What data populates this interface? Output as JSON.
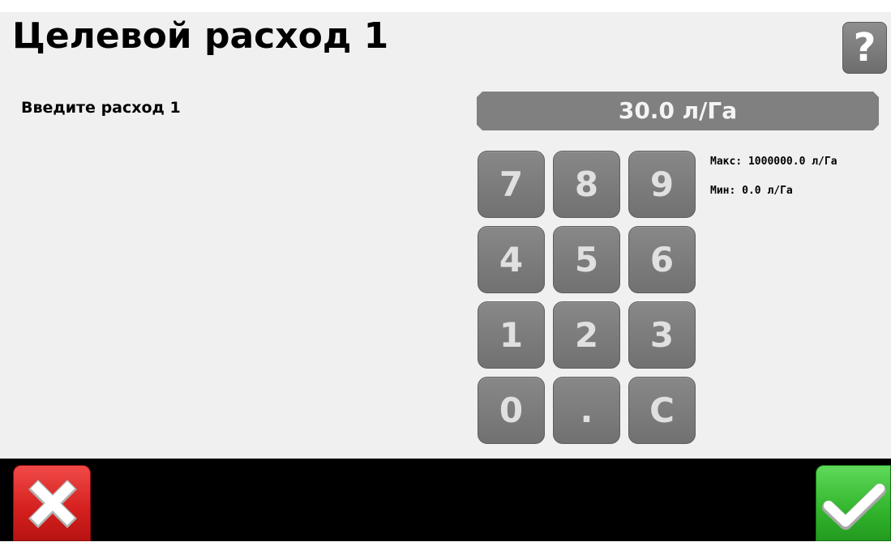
{
  "header": {
    "title": "Целевой расход 1",
    "help_label": "?"
  },
  "form": {
    "prompt": "Введите расход 1",
    "value": "30.0 л/Га",
    "max_label": "Макс: 1000000.0 л/Га",
    "min_label": "Мин: 0.0 л/Га"
  },
  "keypad": {
    "keys": [
      "7",
      "8",
      "9",
      "4",
      "5",
      "6",
      "1",
      "2",
      "3",
      "0",
      ".",
      "C"
    ]
  },
  "footer": {
    "cancel_icon": "x-icon",
    "confirm_icon": "checkmark-icon"
  },
  "colors": {
    "background": "#f0f0f0",
    "key": "#808080",
    "cancel": "#d41f1d",
    "confirm": "#32b52d",
    "bar": "#000000"
  }
}
